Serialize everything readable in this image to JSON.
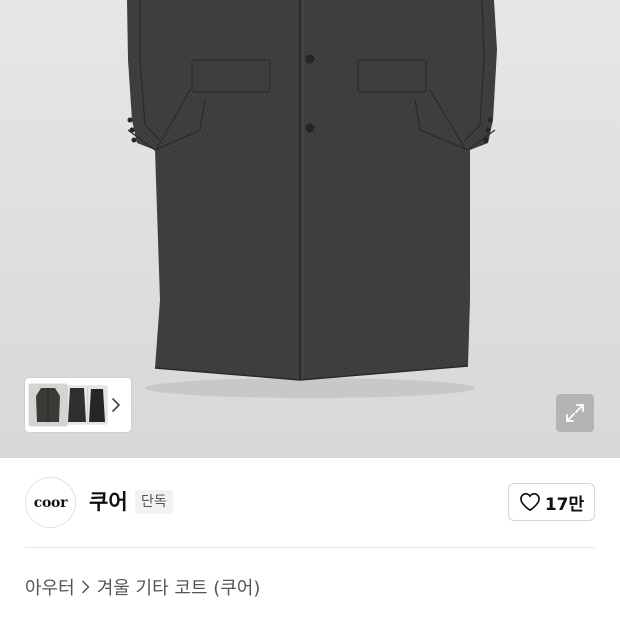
{
  "gallery": {
    "thumbnails": [
      {
        "icon": "coat-thumbnail-1"
      },
      {
        "icon": "coat-thumbnail-2"
      },
      {
        "icon": "coat-thumbnail-3"
      }
    ],
    "next_icon": "chevron-right-icon",
    "expand_icon": "expand-icon"
  },
  "brand": {
    "logo_text": "coor",
    "name": "쿠어",
    "badge": "단독"
  },
  "like": {
    "icon": "heart-icon",
    "count": "17만"
  },
  "breadcrumb": {
    "items": [
      "아우터",
      "겨울 기타 코트 (쿠어)"
    ],
    "separator_icon": "chevron-right-icon"
  },
  "colors": {
    "coat": "#3a3a3a",
    "background": "#e2e2e2"
  }
}
